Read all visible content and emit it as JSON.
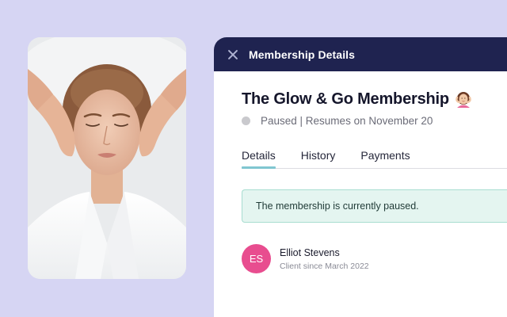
{
  "panel": {
    "header_title": "Membership Details",
    "membership_title": "The Glow & Go Membership",
    "title_emoji_icon": "woman-getting-massage-icon",
    "status": {
      "text": "Paused | Resumes on November 20",
      "dot_color": "#c9c9cd"
    },
    "tabs": [
      {
        "label": "Details",
        "active": true
      },
      {
        "label": "History",
        "active": false
      },
      {
        "label": "Payments",
        "active": false
      }
    ],
    "alert": {
      "text": "The membership is currently paused.",
      "color": "#e4f5f0"
    },
    "client": {
      "initials": "ES",
      "name": "Elliot Stevens",
      "since": "Client since March 2022",
      "avatar_color": "#e84d8f"
    }
  },
  "colors": {
    "background": "#d6d5f3",
    "header": "#1f2350",
    "tab_underline": "#80c6d1"
  }
}
